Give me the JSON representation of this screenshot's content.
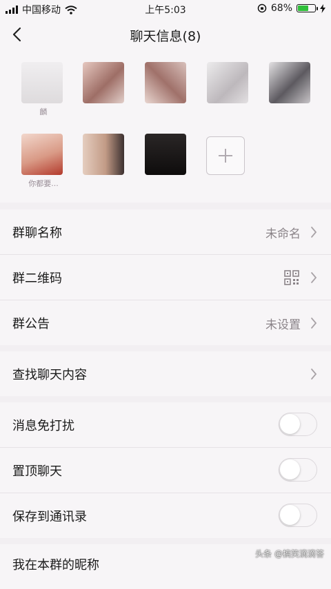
{
  "status_bar": {
    "carrier": "中国移动",
    "time": "上午5:03",
    "battery": "68%",
    "battery_level": 0.68
  },
  "nav": {
    "title": "聊天信息(8)"
  },
  "members": [
    {
      "name": "麟",
      "color": "#e8e4e6"
    },
    {
      "name": "",
      "color": "#c7a39b"
    },
    {
      "name": "",
      "color": "#b58d86"
    },
    {
      "name": "",
      "color": "#cfcbcd"
    },
    {
      "name": "",
      "color": "#7d7a80"
    },
    {
      "name": "你都要...",
      "color": "#d4a594"
    },
    {
      "name": "",
      "color": "#b89a8c"
    },
    {
      "name": "",
      "color": "#1a1818"
    }
  ],
  "settings": {
    "group_name_label": "群聊名称",
    "group_name_value": "未命名",
    "qrcode_label": "群二维码",
    "notice_label": "群公告",
    "notice_value": "未设置",
    "search_label": "查找聊天内容",
    "mute_label": "消息免打扰",
    "pin_label": "置顶聊天",
    "save_label": "保存到通讯录",
    "nickname_label": "我在本群的昵称"
  },
  "toggles": {
    "mute": false,
    "pin": false,
    "save": false
  },
  "watermark": "头条 @搞笑滴滴答"
}
